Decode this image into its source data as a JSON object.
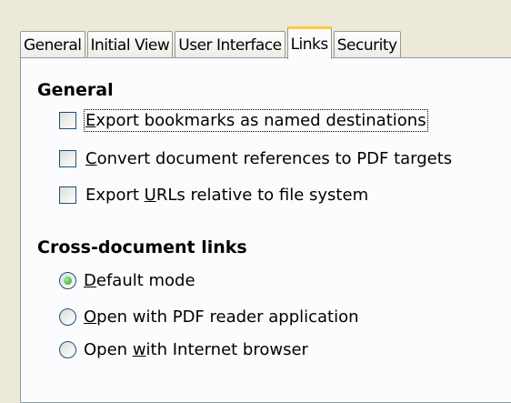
{
  "tabs": [
    {
      "label": "General"
    },
    {
      "label": "Initial View"
    },
    {
      "label": "User Interface"
    },
    {
      "label": "Links"
    },
    {
      "label": "Security"
    }
  ],
  "active_tab": "Links",
  "general": {
    "title": "General",
    "options": [
      {
        "mnemonic": "E",
        "rest": "xport bookmarks as named destinations",
        "checked": false
      },
      {
        "mnemonic": "C",
        "rest": "onvert document references to PDF targets",
        "checked": false
      },
      {
        "pre": "Export ",
        "mnemonic": "U",
        "rest": "RLs relative to file system",
        "checked": false
      }
    ]
  },
  "cross_document": {
    "title": "Cross-document links",
    "options": [
      {
        "mnemonic": "D",
        "rest": "efault mode",
        "selected": true
      },
      {
        "mnemonic": "O",
        "rest": "pen with PDF reader application",
        "selected": false
      },
      {
        "pre": "Open ",
        "mnemonic": "w",
        "rest": "ith Internet browser",
        "selected": false
      }
    ]
  }
}
